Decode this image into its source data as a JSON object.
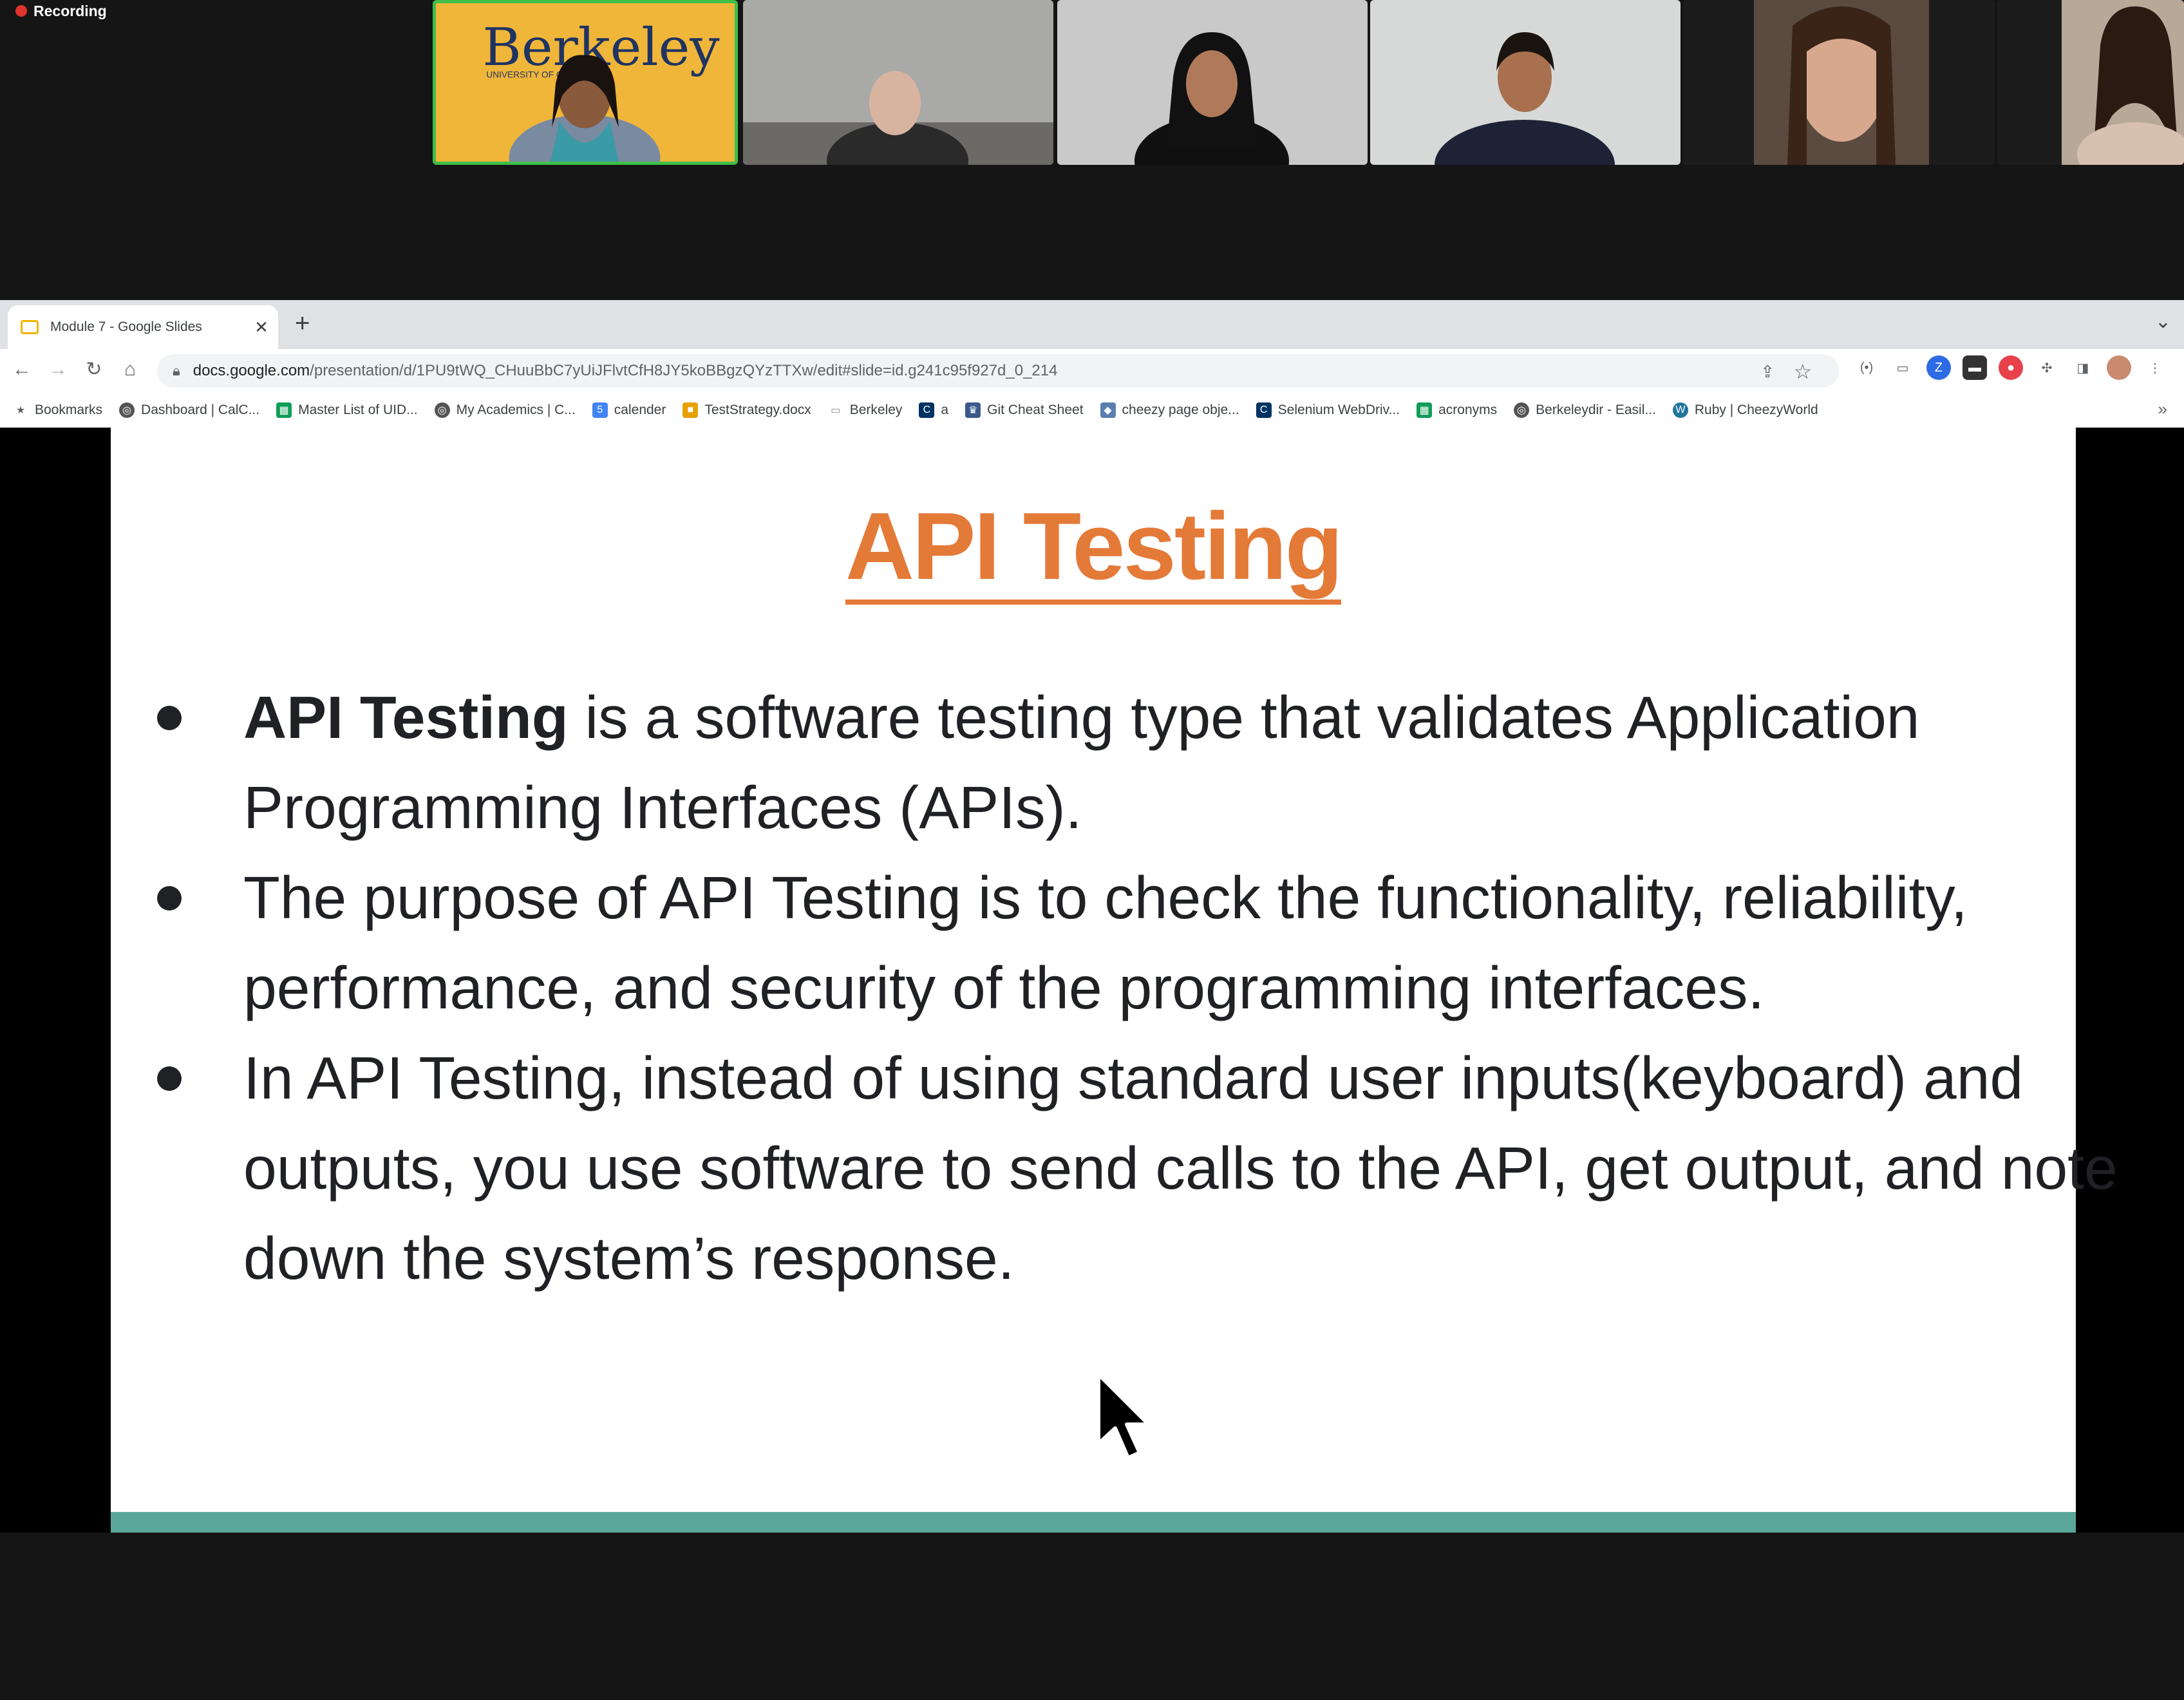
{
  "meeting": {
    "recording_label": "Recording",
    "participants": [
      {
        "name": "participant-presenter",
        "bg": "#f0b63a",
        "backdrop_text": "Berkeley",
        "backdrop_sub": "UNIVERSITY OF CALIFORNIA"
      },
      {
        "name": "participant-2",
        "bg": "#9a9a9a"
      },
      {
        "name": "participant-3",
        "bg": "#c7c7c7"
      },
      {
        "name": "participant-4",
        "bg": "#cfd3d2"
      },
      {
        "name": "participant-5",
        "bg": "#6a5546"
      },
      {
        "name": "participant-6",
        "bg": "#8a7c6e"
      }
    ]
  },
  "browser": {
    "tab_title": "Module 7 - Google Slides",
    "url_host": "docs.google.com",
    "url_path": "/presentation/d/1PU9tWQ_CHuuBbC7yUiJFlvtCfH8JY5koBBgzQYzTTXw/edit#slide=id.g241c95f927d_0_214",
    "bookmarks": [
      {
        "label": "Bookmarks",
        "icon": "star-icon",
        "color": "#5f6368"
      },
      {
        "label": "Dashboard | CalC...",
        "icon": "globe-icon",
        "color": "#555555"
      },
      {
        "label": "Master List of UID...",
        "icon": "sheets-icon",
        "color": "#0f9d58"
      },
      {
        "label": "My Academics | C...",
        "icon": "globe-icon",
        "color": "#555555"
      },
      {
        "label": "calender",
        "icon": "calendar-icon",
        "color": "#4285f4"
      },
      {
        "label": "TestStrategy.docx",
        "icon": "windows-icon",
        "color": "#e8a000"
      },
      {
        "label": "Berkeley",
        "icon": "folder-icon",
        "color": "#8a8a8a"
      },
      {
        "label": "a",
        "icon": "cal-icon",
        "color": "#003262"
      },
      {
        "label": "Git Cheat Sheet",
        "icon": "trophy-icon",
        "color": "#3a5a8c"
      },
      {
        "label": "cheezy page obje...",
        "icon": "link-icon",
        "color": "#5a7fb0"
      },
      {
        "label": "Selenium WebDriv...",
        "icon": "cal-icon",
        "color": "#003262"
      },
      {
        "label": "acronyms",
        "icon": "sheets-icon",
        "color": "#0f9d58"
      },
      {
        "label": "Berkeleydir - Easil...",
        "icon": "globe-icon",
        "color": "#555555"
      },
      {
        "label": "Ruby | CheezyWorld",
        "icon": "wordpress-icon",
        "color": "#21759b"
      }
    ]
  },
  "slide": {
    "title": "API Testing",
    "bullet1_bold": "API Testing",
    "bullet1_rest": " is a software testing type that validates Application Programming Interfaces (APIs).",
    "bullet2": "The purpose of API Testing is to check the functionality, reliability, performance, and security of the programming interfaces.",
    "bullet3": "In API Testing, instead of using standard user inputs(keyboard) and outputs, you use software to send calls to the API, get output, and note down the system’s response."
  }
}
